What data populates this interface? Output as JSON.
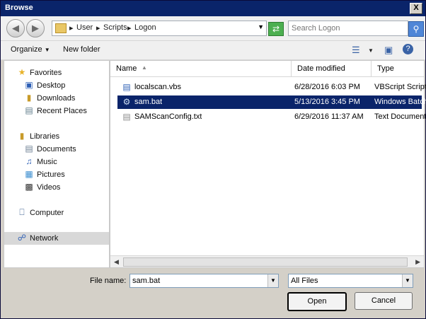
{
  "window": {
    "title": "Browse",
    "close_label": "X"
  },
  "navigation": {
    "breadcrumb": [
      "User",
      "Scripts",
      "Logon"
    ],
    "search_placeholder": "Search Logon"
  },
  "toolbar": {
    "organize_label": "Organize",
    "new_folder_label": "New folder"
  },
  "sidebar": {
    "favorites": {
      "label": "Favorites",
      "items": [
        "Desktop",
        "Downloads",
        "Recent Places"
      ]
    },
    "libraries": {
      "label": "Libraries",
      "items": [
        "Documents",
        "Music",
        "Pictures",
        "Videos"
      ]
    },
    "computer_label": "Computer",
    "network_label": "Network",
    "selected": "Network"
  },
  "file_list": {
    "columns": [
      "Name",
      "Date modified",
      "Type"
    ],
    "rows": [
      {
        "name": "localscan.vbs",
        "date": "6/28/2016 6:03 PM",
        "type": "VBScript Script F",
        "icon": "vbs-file-icon"
      },
      {
        "name": "sam.bat",
        "date": "5/13/2016 3:45 PM",
        "type": "Windows Batch",
        "icon": "batch-file-icon"
      },
      {
        "name": "SAMScanConfig.txt",
        "date": "6/29/2016 11:37 AM",
        "type": "Text Document",
        "icon": "text-file-icon"
      }
    ],
    "selected_row": "sam.bat"
  },
  "footer": {
    "filename_label": "File name:",
    "filename_value": "sam.bat",
    "filetype_value": "All Files",
    "open_label": "Open",
    "cancel_label": "Cancel"
  },
  "colors": {
    "titlebar": "#0a246a",
    "selection": "#0a246a",
    "refresh": "#4caf50",
    "search_button": "#4f86d7"
  }
}
